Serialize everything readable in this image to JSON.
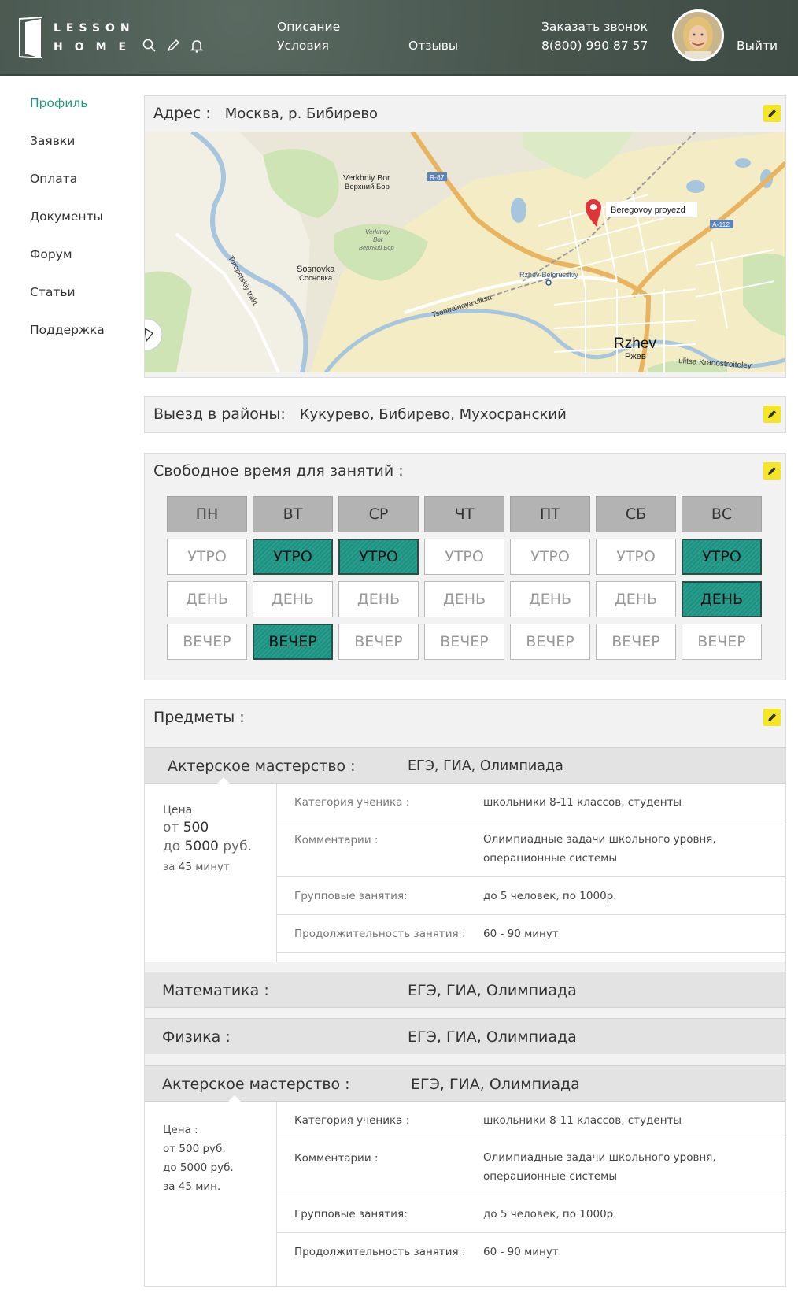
{
  "header": {
    "logo_line1": "LESSON",
    "logo_line2": "HOME",
    "nav_description": "Описание",
    "nav_conditions": "Условия",
    "nav_reviews": "Отзывы",
    "callback_label": "Заказать звонок",
    "phone": "8(800) 990 87 57",
    "logout": "Выйти"
  },
  "sidebar": {
    "items": [
      {
        "label": "Профиль",
        "active": true
      },
      {
        "label": "Заявки"
      },
      {
        "label": "Оплата"
      },
      {
        "label": "Документы"
      },
      {
        "label": "Форум"
      },
      {
        "label": "Статьи"
      },
      {
        "label": "Поддержка"
      }
    ]
  },
  "address": {
    "label": "Адрес :",
    "value": "Москва, р. Бибирево"
  },
  "map": {
    "labels": {
      "verkhniy_bor": "Verkhniy Bor",
      "verkhniy_bor_ru": "Верхний Бор",
      "verkhniy_bor_small": "Verkhniy",
      "verkhniy_bor_small2": "Bor",
      "verkhniy_bor_small_ru": "Верхний Бор",
      "r87": "R-87",
      "a112": "A-112",
      "sosnovka": "Sosnovka",
      "sosnovka_ru": "Сосновка",
      "toropetskiy": "Toropetskiy trakt",
      "tsentralnaya": "Tsentralnaya ulitsa",
      "rzhev_belorusskiy": "Rzhev-Belorusskiy",
      "marker": "Beregovoy proyezd",
      "rzhev": "Rzhev",
      "rzhev_ru": "Ржев",
      "kranostroiteley": "ulitsa Kranostroiteley"
    }
  },
  "districts": {
    "label": "Выезд в районы:",
    "value": "Кукурево, Бибирево, Мухосранский"
  },
  "schedule": {
    "label": "Свободное время для занятий :",
    "days": [
      "ПН",
      "ВТ",
      "СР",
      "ЧТ",
      "ПТ",
      "СБ",
      "ВС"
    ],
    "slots": [
      "УТРО",
      "ДЕНЬ",
      "ВЕЧЕР"
    ],
    "selected": {
      "УТРО": [
        false,
        true,
        true,
        false,
        false,
        false,
        true
      ],
      "ДЕНЬ": [
        false,
        false,
        false,
        false,
        false,
        false,
        true
      ],
      "ВЕЧЕР": [
        false,
        true,
        false,
        false,
        false,
        false,
        false
      ]
    },
    "accent_color": "#1e9786"
  },
  "subjects": {
    "label": "Предметы :",
    "items": [
      {
        "name": "Актерское мастерство :",
        "exams": "ЕГЭ, ГИА, Олимпиада",
        "price_label": "Цена",
        "price_from_prefix": "от",
        "price_from": "500",
        "price_to_prefix": "до",
        "price_to": "5000",
        "price_currency": "руб.",
        "duration_prefix": "за",
        "duration_value": "45",
        "duration_unit": "минут",
        "category_label": "Категория ученика :",
        "category_value": "школьники 8-11 классов, студенты",
        "comments_label": "Комментарии :",
        "comments_line1": "Олимпиадные задачи школьного уровня,",
        "comments_line2": "операционные системы",
        "group_label": "Групповые занятия:",
        "group_value": "до 5 человек, по 1000р.",
        "length_label": "Продолжительность занятия :",
        "length_value": "60 - 90 минут"
      },
      {
        "name": "Математика :",
        "exams": "ЕГЭ, ГИА, Олимпиада"
      },
      {
        "name": "Физика :",
        "exams": "ЕГЭ, ГИА, Олимпиада"
      },
      {
        "name": "Актерское мастерство :",
        "exams": "ЕГЭ, ГИА, Олимпиада",
        "price_label": "Цена :",
        "price_from": "от 500 руб.",
        "price_to": "до 5000 руб.",
        "duration": "за 45 мин.",
        "category_label": "Категория ученика :",
        "category_value": "школьники 8-11 классов, студенты",
        "comments_label": "Комментарии :",
        "comments_line1": "Олимпиадные задачи школьного уровня,",
        "comments_line2": "операционные системы",
        "group_label": "Групповые занятия:",
        "group_value": "до 5 человек, по 1000р.",
        "length_label": "Продолжительность занятия :",
        "length_value": "60 - 90 минут"
      }
    ]
  }
}
